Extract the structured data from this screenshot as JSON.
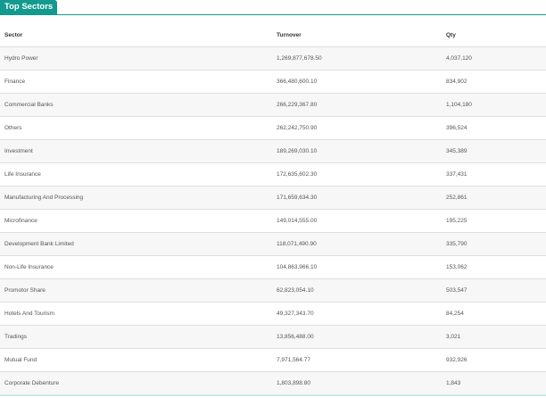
{
  "widget": {
    "title": "Top Sectors"
  },
  "table": {
    "headers": {
      "sector": "Sector",
      "turnover": "Turnover",
      "qty": "Qty"
    },
    "rows": [
      {
        "sector": "Hydro Power",
        "turnover": "1,269,877,678.50",
        "qty": "4,037,120"
      },
      {
        "sector": "Finance",
        "turnover": "366,480,600.10",
        "qty": "834,902"
      },
      {
        "sector": "Commercial Banks",
        "turnover": "266,229,367.80",
        "qty": "1,104,180"
      },
      {
        "sector": "Others",
        "turnover": "262,242,750.90",
        "qty": "396,524"
      },
      {
        "sector": "Investment",
        "turnover": "189,269,030.10",
        "qty": "345,389"
      },
      {
        "sector": "Life Insurance",
        "turnover": "172,635,602.30",
        "qty": "337,431"
      },
      {
        "sector": "Manufacturing And Processing",
        "turnover": "171,659,634.30",
        "qty": "252,861"
      },
      {
        "sector": "Microfinance",
        "turnover": "149,014,555.00",
        "qty": "195,225"
      },
      {
        "sector": "Development Bank Limited",
        "turnover": "118,071,490.90",
        "qty": "335,790"
      },
      {
        "sector": "Non-Life Insurance",
        "turnover": "104,863,966.10",
        "qty": "153,062"
      },
      {
        "sector": "Promotor Share",
        "turnover": "62,823,054.10",
        "qty": "503,547"
      },
      {
        "sector": "Hotels And Tourism",
        "turnover": "49,327,343.70",
        "qty": "84,254"
      },
      {
        "sector": "Tradings",
        "turnover": "13,856,488.00",
        "qty": "3,021"
      },
      {
        "sector": "Mutual Fund",
        "turnover": "7,971,564.77",
        "qty": "932,926"
      },
      {
        "sector": "Corporate Debenture",
        "turnover": "1,803,898.80",
        "qty": "1,843"
      }
    ]
  },
  "colors": {
    "accent": "#139a8e"
  }
}
